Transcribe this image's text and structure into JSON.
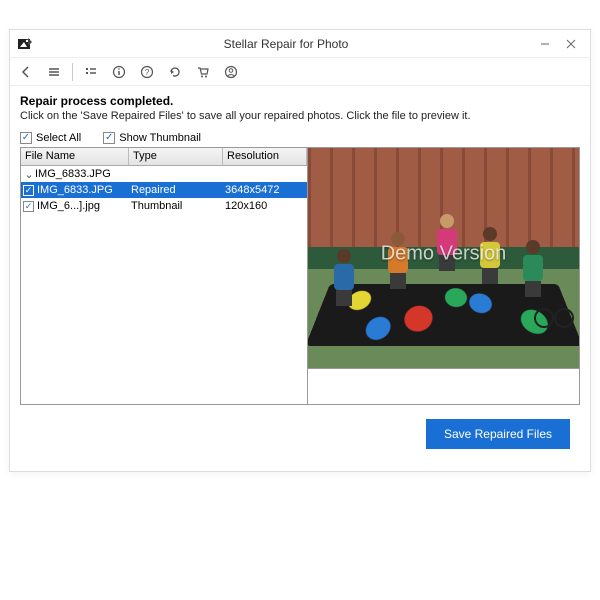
{
  "window": {
    "title": "Stellar Repair for Photo"
  },
  "heading": "Repair process completed.",
  "subtext": "Click on the 'Save Repaired Files' to save all your repaired photos. Click the file to preview it.",
  "checks": {
    "select_all": "Select All",
    "show_thumbnail": "Show Thumbnail"
  },
  "table": {
    "headers": {
      "file": "File Name",
      "type": "Type",
      "resolution": "Resolution"
    },
    "parent": {
      "name": "IMG_6833.JPG"
    },
    "rows": [
      {
        "name": "IMG_6833.JPG",
        "type": "Repaired",
        "resolution": "3648x5472",
        "selected": true
      },
      {
        "name": "IMG_6...].jpg",
        "type": "Thumbnail",
        "resolution": "120x160",
        "selected": false
      }
    ]
  },
  "preview": {
    "watermark": "Demo Version"
  },
  "footer": {
    "save_button": "Save Repaired Files"
  }
}
